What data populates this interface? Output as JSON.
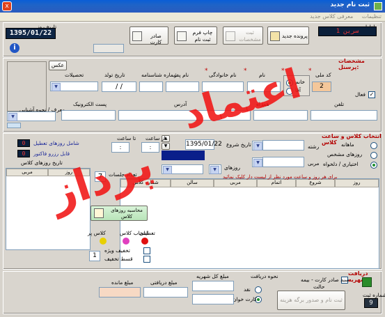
{
  "window": {
    "title": "ثبت نام جدید",
    "close_glyph": "x"
  },
  "menu": [
    "تنظیمات",
    "معرفی کلاس جدید"
  ],
  "header": {
    "date_label": "تاریخ روز",
    "date_value": "1395/01/22",
    "info_glyph": "i",
    "shard_label": "ادارات",
    "shard_value": "سرین 1",
    "buttons": {
      "new_file": "پرونده جدید",
      "register": "ثبت مشخصات",
      "print": "چاپ فرم ثبت نام",
      "add_card": "صادر کارت"
    }
  },
  "personal": {
    "section_title": "مشخصات پرسنل:",
    "photo_label": "عکس",
    "code_label": "کد ملی",
    "name_label": "نام",
    "family_label": "نام خانوادگی",
    "father_label": "نام پدر",
    "id_label": "شماره شناسنامه",
    "birth_label": "تاریخ تولد",
    "birth_value": "/ /",
    "edu_label": "تحصیلات",
    "gender_female": "خانم",
    "gender_male": "آقا",
    "code_value": "2",
    "active_label": "فعال",
    "mobile_label": "تلفن",
    "phone_label": "همراه",
    "address_label": "آدرس",
    "postal_label": "پست الکترونیک",
    "referrer_label": "معرف / نحوه آشنایی"
  },
  "class": {
    "section_title": "انتخاب کلاس و ساعت کلاس",
    "opt_monthly": "ماهانه",
    "opt_day": "روزهای مشخص",
    "opt_custom": "اختیاری / دلخواه",
    "field_label": "رشته",
    "coach_label": "مربی",
    "start_label": "تاریخ شروع",
    "start_value": "1395/01/22",
    "days_label": "روزهای",
    "sessions_label": "تعداد جلسات",
    "sessions_value": "7",
    "selected_value": "7",
    "from_label": "از ساعت",
    "to_label": "تا ساعت",
    "time_value": ": ",
    "notice": "برای هر روز و ساعت مورد نظر از لیست دار کلیک نمائید",
    "holidays_label": "شامل روزهای تعطیل",
    "holidays_count": "0",
    "sessions_count_label": "قابل رزرو فاکتور",
    "sessions_count": "0",
    "history_label": "تاریخ روزهای کلاس",
    "grid_cols": [
      "روز",
      "شروع",
      "اتمام",
      "مربی",
      "سالن",
      "شماره کلاس"
    ],
    "list_cols": [
      "مربی",
      "روز"
    ],
    "calc_button": "محاسبه روزهای کلاس",
    "legend_red": "تعطیلی",
    "legend_pink": "انتخاب کلاس",
    "legend_yellow": "کلاس پر",
    "legend_green": "انتخاب شده",
    "chk_discount": "تخفیف ویژه",
    "chk_half": "قسط تخفیف",
    "discount_value": "1"
  },
  "payment": {
    "section_title": "دریافت شهریه",
    "card_label": "سند صادر کارت - بیمه",
    "status_label": "حالت",
    "receipt_no_label": "شماره ثبت",
    "receipt_no_value": "9",
    "method_label": "نحوه دریافت",
    "cash_label": "نقد",
    "card_pay_label": "کارت خوان",
    "total_label": "مبلغ کل شهریه",
    "paid_label": "مبلغ دریافتی",
    "remaining_label": "مبلغ مانده",
    "final_button": "ثبت نام و صدور برگه هزینه"
  },
  "watermark": {
    "line1": "اعتماد",
    "line2": "پرداز"
  }
}
